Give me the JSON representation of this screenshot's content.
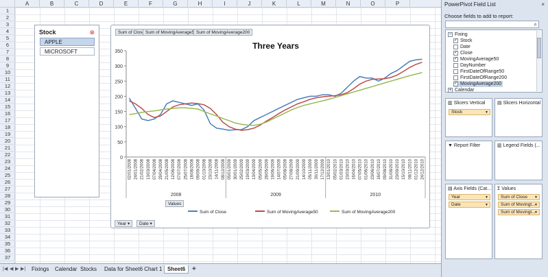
{
  "sheet": {
    "columns": [
      "A",
      "B",
      "C",
      "D",
      "E",
      "F",
      "G",
      "H",
      "I",
      "J",
      "K",
      "L",
      "M",
      "N",
      "O",
      "P"
    ],
    "rows": [
      "1",
      "2",
      "3",
      "4",
      "5",
      "6",
      "7",
      "8",
      "9",
      "10",
      "11",
      "12",
      "13",
      "14",
      "15",
      "16",
      "17",
      "18",
      "19",
      "20",
      "21",
      "22",
      "23",
      "24",
      "25",
      "26",
      "27",
      "28",
      "29",
      "30",
      "31",
      "32",
      "33",
      "34",
      "35",
      "36",
      "37"
    ],
    "tabs": [
      "Fixings",
      "Calendar",
      "Stocks",
      "Data for Sheet6 Chart 1",
      "Sheet6"
    ],
    "active_tab": "Sheet6"
  },
  "slicer": {
    "title": "Stock",
    "clear_icon": "clear-filter-icon",
    "items": [
      {
        "label": "APPLE",
        "selected": true
      },
      {
        "label": "MICROSOFT",
        "selected": false
      }
    ]
  },
  "chart": {
    "value_field_buttons": [
      "Sum of Close",
      "Sum of MovingAverage50",
      "Sum of MovingAverage200"
    ],
    "values_button": "Values",
    "axis_field_buttons": [
      "Year",
      "Date"
    ]
  },
  "chart_data": {
    "type": "line",
    "title": "Three Years",
    "ylim": [
      0,
      350
    ],
    "yticks": [
      0,
      50,
      100,
      150,
      200,
      250,
      300,
      350
    ],
    "x_tick_labels": [
      "02/01/2008",
      "24/01/2008",
      "21/02/2008",
      "13/03/2008",
      "07/04/2008",
      "29/04/2008",
      "21/05/2008",
      "12/06/2008",
      "07/07/2008",
      "25/07/2008",
      "18/08/2008",
      "09/09/2008",
      "01/10/2008",
      "23/10/2008",
      "14/11/2008",
      "08/12/2008",
      "05/01/2009",
      "30/01/2009",
      "25/02/2009",
      "19/03/2009",
      "13/04/2009",
      "05/05/2009",
      "28/05/2009",
      "19/06/2009",
      "14/07/2009",
      "05/08/2009",
      "27/08/2009",
      "21/09/2009",
      "14/10/2009",
      "05/11/2009",
      "30/11/2009",
      "17/12/2009",
      "13/01/2010",
      "05/02/2010",
      "01/03/2010",
      "23/03/2010",
      "16/04/2010",
      "07/05/2010",
      "01/06/2010",
      "23/06/2010",
      "16/07/2010",
      "09/08/2010",
      "31/08/2010",
      "23/09/2010",
      "15/10/2010",
      "08/11/2010",
      "01/12/2010",
      "24/12/2010"
    ],
    "year_labels": [
      "2008",
      "2009",
      "2010"
    ],
    "series": [
      {
        "name": "Sum of Close",
        "color": "#4a7ebb",
        "values": [
          194,
          160,
          125,
          120,
          125,
          140,
          175,
          185,
          180,
          175,
          170,
          175,
          155,
          110,
          95,
          92,
          88,
          90,
          90,
          100,
          120,
          130,
          140,
          150,
          160,
          170,
          180,
          190,
          195,
          200,
          200,
          205,
          205,
          200,
          210,
          230,
          250,
          265,
          260,
          260,
          250,
          260,
          275,
          285,
          300,
          315,
          320,
          322
        ]
      },
      {
        "name": "Sum of MovingAverage50",
        "color": "#be4b48",
        "values": [
          185,
          175,
          160,
          140,
          130,
          135,
          150,
          165,
          172,
          175,
          178,
          176,
          172,
          160,
          140,
          115,
          100,
          92,
          88,
          90,
          95,
          105,
          118,
          130,
          143,
          155,
          165,
          175,
          182,
          190,
          195,
          198,
          200,
          202,
          205,
          212,
          225,
          240,
          250,
          256,
          257,
          258,
          262,
          270,
          282,
          295,
          305,
          312
        ]
      },
      {
        "name": "Sum of MovingAverage200",
        "color": "#98b954",
        "values": [
          140,
          143,
          147,
          150,
          152,
          155,
          158,
          160,
          162,
          162,
          160,
          158,
          150,
          142,
          135,
          127,
          120,
          112,
          108,
          105,
          104,
          108,
          115,
          125,
          135,
          145,
          155,
          163,
          170,
          175,
          180,
          185,
          190,
          196,
          202,
          208,
          214,
          220,
          226,
          232,
          238,
          244,
          250,
          256,
          262,
          268,
          273,
          278
        ]
      }
    ],
    "legend_position": "bottom",
    "grid": false
  },
  "panel": {
    "title": "PowerPivot Field List",
    "subtitle": "Choose fields to add to report:",
    "close_label": "×",
    "search_icon": "search-icon",
    "fields": [
      {
        "label": "Fixing",
        "kind": "table",
        "expanded": true
      },
      {
        "label": "Stock",
        "checked": true
      },
      {
        "label": "Date",
        "checked": false
      },
      {
        "label": "Close",
        "checked": true
      },
      {
        "label": "MovingAverage50",
        "checked": true
      },
      {
        "label": "DayNumber",
        "checked": false
      },
      {
        "label": "FirstDateOfRange50",
        "checked": false
      },
      {
        "label": "FirstDateOfRange200",
        "checked": false
      },
      {
        "label": "MovingAverage200",
        "checked": true,
        "selected": true
      },
      {
        "label": "Calendar",
        "kind": "table",
        "expanded": false
      }
    ],
    "slicers_vertical": {
      "title": "Slicers Vertical",
      "items": [
        "Stock"
      ]
    },
    "slicers_horizontal": {
      "title": "Slicers Horizontal",
      "items": []
    },
    "report_filter": {
      "title": "Report Filter",
      "items": []
    },
    "legend_fields": {
      "title": "Legend Fields (...",
      "items": []
    },
    "axis_fields": {
      "title": "Axis Fields (Cat...",
      "items": [
        "Year",
        "Date"
      ]
    },
    "values": {
      "title": "Values",
      "items": [
        "Sum of Close",
        "Sum of Movingt...",
        "Sum of Movingt..."
      ]
    }
  }
}
